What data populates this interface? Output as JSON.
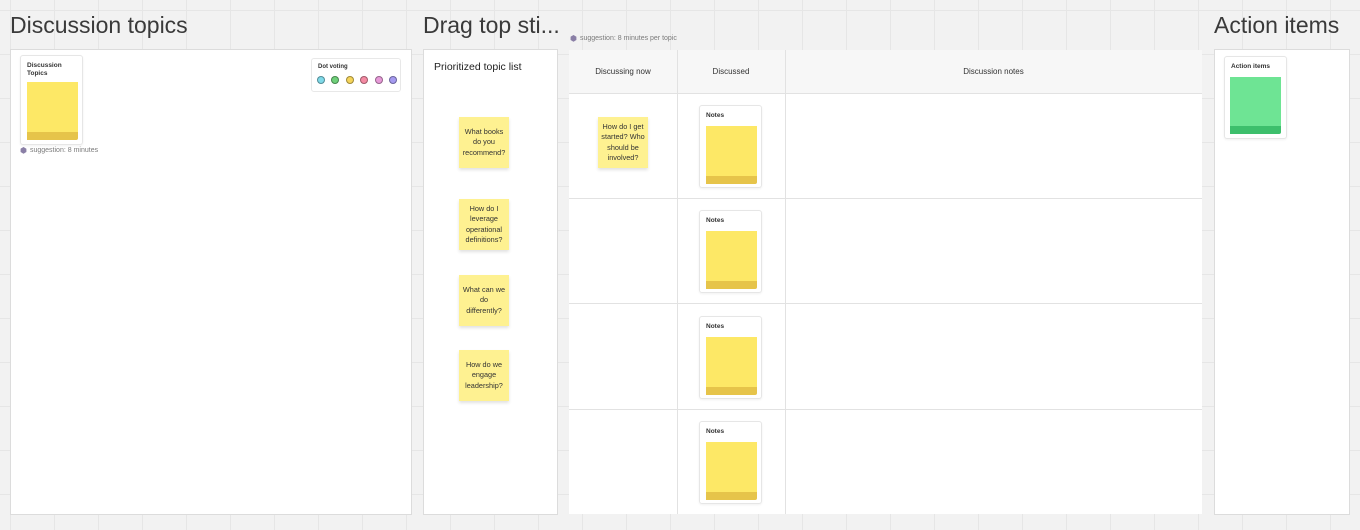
{
  "frames": {
    "discussion": {
      "title": "Discussion topics"
    },
    "drag": {
      "title": "Drag top sti..."
    },
    "actions": {
      "title": "Action items"
    }
  },
  "discussion_card": {
    "title_line1": "Discussion",
    "title_line2": "Topics",
    "hint": "suggestion: 8 minutes"
  },
  "dot_voting": {
    "title": "Dot voting",
    "dots": [
      {
        "color": "#7fd9e8"
      },
      {
        "color": "#6fd07a"
      },
      {
        "color": "#f5d45a"
      },
      {
        "color": "#f48aa3"
      },
      {
        "color": "#e79ad8"
      },
      {
        "color": "#a59af0"
      }
    ]
  },
  "prioritized": {
    "title": "Prioritized topic list",
    "topics": [
      "What books do you recommend?",
      "How do I leverage operational definitions?",
      "What can we do differently?",
      "How do we engage leadership?"
    ]
  },
  "table": {
    "hint": "suggestion: 8 minutes per topic",
    "columns": [
      "Discussing now",
      "Discussed",
      "Discussion notes"
    ],
    "current_topic": "How do I get started? Who should be involved?",
    "notes_label": "Notes"
  },
  "action_card": {
    "title": "Action items"
  },
  "icons": {
    "hint_icon": "stop-icon"
  }
}
